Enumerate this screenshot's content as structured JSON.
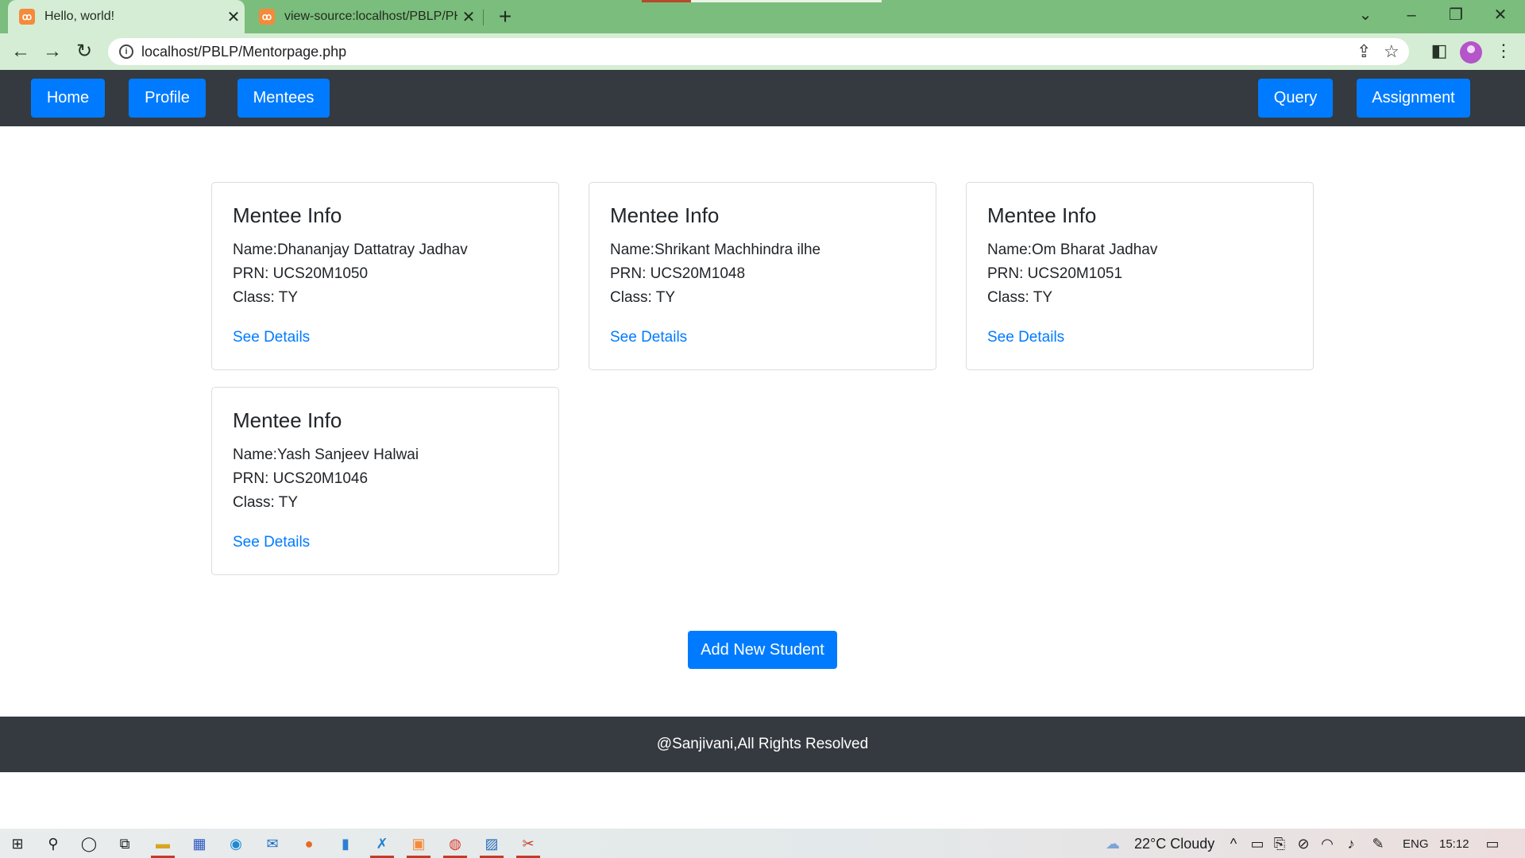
{
  "browser": {
    "tabs": [
      {
        "title": "Hello, world!",
        "active": true
      },
      {
        "title": "view-source:localhost/PBLP/PHo",
        "active": false
      }
    ],
    "url": "localhost/PBLP/Mentorpage.php"
  },
  "nav": {
    "left": [
      "Home",
      "Profile",
      "Mentees"
    ],
    "right": [
      "Query",
      "Assignment"
    ]
  },
  "mentees": [
    {
      "heading": "Mentee Info",
      "name": "Name:Dhananjay Dattatray Jadhav",
      "prn": "PRN: UCS20M1050",
      "class": "Class: TY",
      "link": "See Details"
    },
    {
      "heading": "Mentee Info",
      "name": "Name:Shrikant Machhindra ilhe",
      "prn": "PRN: UCS20M1048",
      "class": "Class: TY",
      "link": "See Details"
    },
    {
      "heading": "Mentee Info",
      "name": "Name:Om Bharat Jadhav",
      "prn": "PRN: UCS20M1051",
      "class": "Class: TY",
      "link": "See Details"
    },
    {
      "heading": "Mentee Info",
      "name": "Name:Yash Sanjeev Halwai",
      "prn": "PRN: UCS20M1046",
      "class": "Class: TY",
      "link": "See Details"
    }
  ],
  "add_button": "Add New Student",
  "footer": "@Sanjivani,All Rights Resolved",
  "taskbar": {
    "weather": "22°C  Cloudy",
    "lang": "ENG",
    "time": "15:12"
  },
  "colors": {
    "primary": "#007bff",
    "navbar": "#343a40",
    "browser_frame": "#7bbd7c"
  }
}
